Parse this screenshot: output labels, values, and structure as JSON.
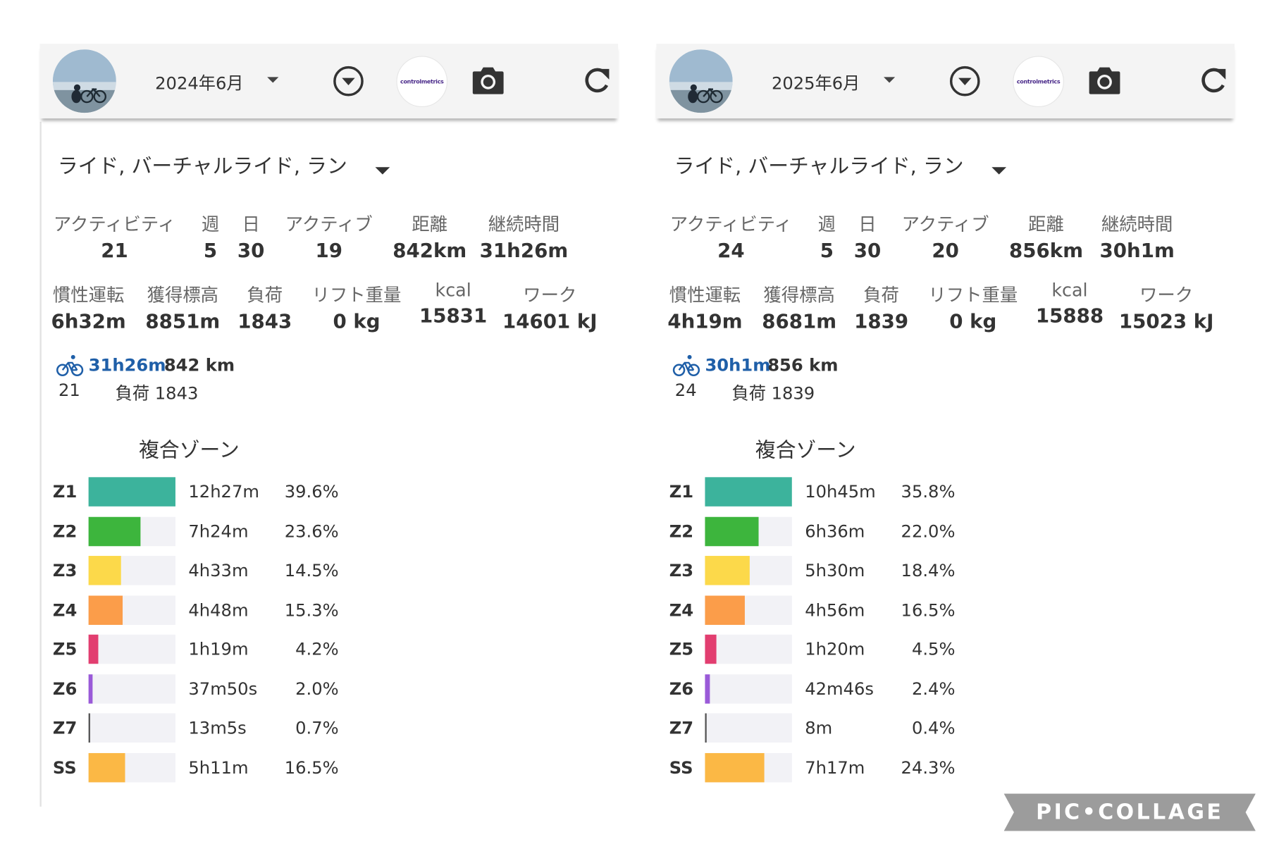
{
  "watermark": "PIC•COLLAGE",
  "panels": [
    {
      "month": "2024年6月",
      "logo_text": "controlmetrics",
      "filter": "ライド, バーチャルライド, ラン",
      "stats_row1": [
        {
          "label": "アクティビティ",
          "value": "21"
        },
        {
          "label": "週",
          "value": "5"
        },
        {
          "label": "日",
          "value": "30"
        },
        {
          "label": "アクティブ",
          "value": "19"
        },
        {
          "label": "距離",
          "value": "842km"
        },
        {
          "label": "継続時間",
          "value": "31h26m"
        }
      ],
      "stats_row2": [
        {
          "label": "慣性運転",
          "value": "6h32m"
        },
        {
          "label": "獲得標高",
          "value": "8851m"
        },
        {
          "label": "負荷",
          "value": "1843"
        },
        {
          "label": "リフト重量",
          "value": "0 kg"
        },
        {
          "label": "kcal",
          "value": "15831"
        },
        {
          "label": "ワーク",
          "value": "14601 kJ"
        }
      ],
      "summary": {
        "time": "31h26m",
        "distance": "842 km",
        "count": "21",
        "load": "負荷 1843"
      },
      "zones_title": "複合ゾーン",
      "zones": [
        {
          "zone": "Z1",
          "time": "12h27m",
          "pct": "39.6%",
          "fraction": 1.0,
          "color": "#3cb39c"
        },
        {
          "zone": "Z2",
          "time": "7h24m",
          "pct": "23.6%",
          "fraction": 0.6,
          "color": "#3db53d"
        },
        {
          "zone": "Z3",
          "time": "4h33m",
          "pct": "14.5%",
          "fraction": 0.37,
          "color": "#fcd94a"
        },
        {
          "zone": "Z4",
          "time": "4h48m",
          "pct": "15.3%",
          "fraction": 0.39,
          "color": "#fb9d4a"
        },
        {
          "zone": "Z5",
          "time": "1h19m",
          "pct": "4.2%",
          "fraction": 0.11,
          "color": "#e23e70"
        },
        {
          "zone": "Z6",
          "time": "37m50s",
          "pct": "2.0%",
          "fraction": 0.05,
          "color": "#9a5ad8"
        },
        {
          "zone": "Z7",
          "time": "13m5s",
          "pct": "0.7%",
          "fraction": 0.018,
          "color": "#555555"
        },
        {
          "zone": "SS",
          "time": "5h11m",
          "pct": "16.5%",
          "fraction": 0.42,
          "color": "#fbb845"
        }
      ]
    },
    {
      "month": "2025年6月",
      "logo_text": "controlmetrics",
      "filter": "ライド, バーチャルライド, ラン",
      "stats_row1": [
        {
          "label": "アクティビティ",
          "value": "24"
        },
        {
          "label": "週",
          "value": "5"
        },
        {
          "label": "日",
          "value": "30"
        },
        {
          "label": "アクティブ",
          "value": "20"
        },
        {
          "label": "距離",
          "value": "856km"
        },
        {
          "label": "継続時間",
          "value": "30h1m"
        }
      ],
      "stats_row2": [
        {
          "label": "慣性運転",
          "value": "4h19m"
        },
        {
          "label": "獲得標高",
          "value": "8681m"
        },
        {
          "label": "負荷",
          "value": "1839"
        },
        {
          "label": "リフト重量",
          "value": "0 kg"
        },
        {
          "label": "kcal",
          "value": "15888"
        },
        {
          "label": "ワーク",
          "value": "15023 kJ"
        }
      ],
      "summary": {
        "time": "30h1m",
        "distance": "856 km",
        "count": "24",
        "load": "負荷 1839"
      },
      "zones_title": "複合ゾーン",
      "zones": [
        {
          "zone": "Z1",
          "time": "10h45m",
          "pct": "35.8%",
          "fraction": 1.0,
          "color": "#3cb39c"
        },
        {
          "zone": "Z2",
          "time": "6h36m",
          "pct": "22.0%",
          "fraction": 0.62,
          "color": "#3db53d"
        },
        {
          "zone": "Z3",
          "time": "5h30m",
          "pct": "18.4%",
          "fraction": 0.51,
          "color": "#fcd94a"
        },
        {
          "zone": "Z4",
          "time": "4h56m",
          "pct": "16.5%",
          "fraction": 0.46,
          "color": "#fb9d4a"
        },
        {
          "zone": "Z5",
          "time": "1h20m",
          "pct": "4.5%",
          "fraction": 0.13,
          "color": "#e23e70"
        },
        {
          "zone": "Z6",
          "time": "42m46s",
          "pct": "2.4%",
          "fraction": 0.06,
          "color": "#9a5ad8"
        },
        {
          "zone": "Z7",
          "time": "8m",
          "pct": "0.4%",
          "fraction": 0.012,
          "color": "#555555"
        },
        {
          "zone": "SS",
          "time": "7h17m",
          "pct": "24.3%",
          "fraction": 0.68,
          "color": "#fbb845"
        }
      ]
    }
  ]
}
